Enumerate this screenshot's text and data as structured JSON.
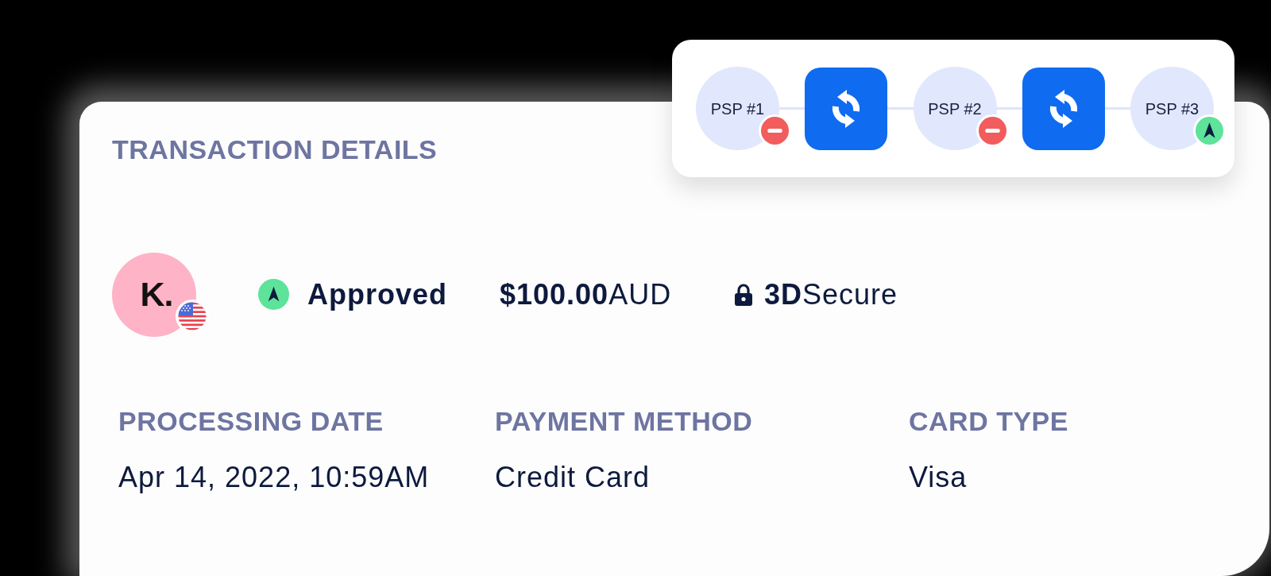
{
  "card": {
    "title": "TRANSACTION DETAILS"
  },
  "summary": {
    "merchant_logo": "K.",
    "approved": true,
    "status_label": "Approved",
    "amount": "**$100.00**AUD",
    "security": "**3D**Secure"
  },
  "fields": [
    {
      "label": "PROCESSING DATE",
      "value": "Apr 14, 2022, 10:59AM"
    },
    {
      "label": "PAYMENT METHOD",
      "value": "Credit Card"
    },
    {
      "label": "CARD TYPE",
      "value": "Visa"
    }
  ],
  "routing": {
    "nodes": [
      {
        "kind": "psp",
        "label": "PSP #1",
        "approved": false
      },
      {
        "kind": "switch"
      },
      {
        "kind": "psp",
        "label": "PSP #2",
        "approved": false
      },
      {
        "kind": "switch"
      },
      {
        "kind": "psp",
        "label": "PSP #3",
        "approved": true
      }
    ]
  }
}
